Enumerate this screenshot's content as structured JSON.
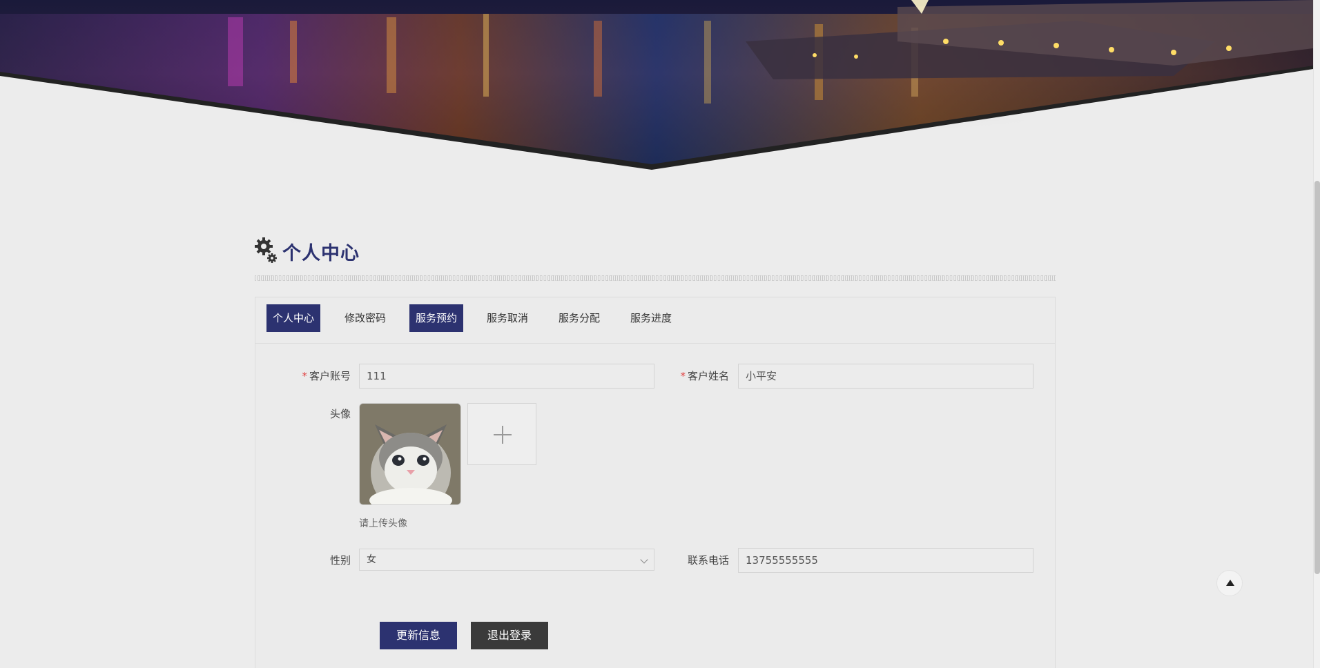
{
  "page": {
    "title": "个人中心",
    "accent": "#2c3270"
  },
  "tabs": [
    {
      "label": "个人中心",
      "active": true
    },
    {
      "label": "修改密码",
      "active": false
    },
    {
      "label": "服务预约",
      "active": true
    },
    {
      "label": "服务取消",
      "active": false
    },
    {
      "label": "服务分配",
      "active": false
    },
    {
      "label": "服务进度",
      "active": false
    }
  ],
  "form": {
    "account_label": "客户账号",
    "account_value": "111",
    "name_label": "客户姓名",
    "name_value": "小平安",
    "avatar_label": "头像",
    "avatar_hint": "请上传头像",
    "gender_label": "性别",
    "gender_value": "女",
    "phone_label": "联系电话",
    "phone_value": "13755555555",
    "required_mark": "*"
  },
  "buttons": {
    "update": "更新信息",
    "logout": "退出登录"
  }
}
